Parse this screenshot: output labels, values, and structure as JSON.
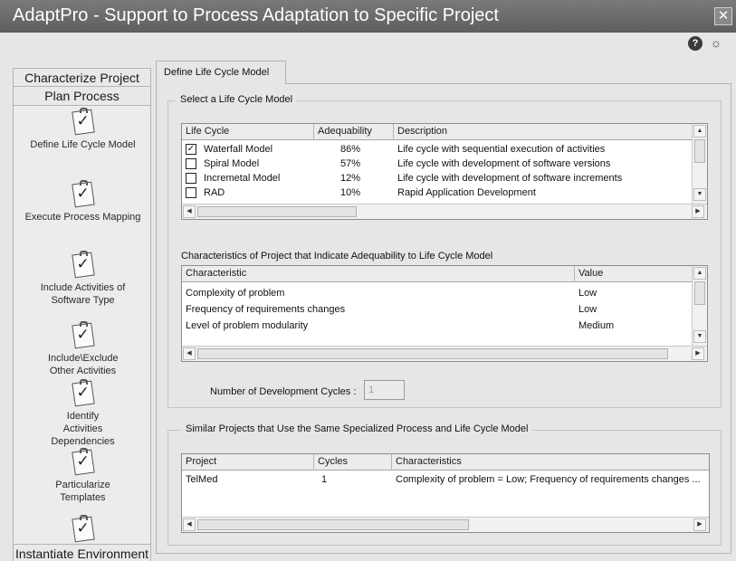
{
  "window": {
    "title": "AdaptPro - Support to Process Adaptation to Specific Project",
    "close_glyph": "✕",
    "help_glyph": "?",
    "bulb_glyph": "☼"
  },
  "sidebar": {
    "characterize_label": "Characterize Project",
    "plan_label": "Plan Process",
    "instantiate_label": "Instantiate Environment",
    "items": [
      {
        "label": "Define Life Cycle Model"
      },
      {
        "label": "Execute Process Mapping"
      },
      {
        "label": "Include Activities of Software Type"
      },
      {
        "label": "Include\\Exclude Other Activities"
      },
      {
        "label": "Identify Activities Dependencies"
      },
      {
        "label": "Particularize Templates"
      }
    ]
  },
  "tabs": [
    {
      "label": "Define Life Cycle Model"
    }
  ],
  "lifecycle_group": {
    "title": "Select a Life Cycle Model",
    "columns": [
      "Life Cycle",
      "Adequability",
      "Description"
    ],
    "rows": [
      {
        "checked": true,
        "name": "Waterfall Model",
        "adequability": "86%",
        "description": "Life cycle with sequential execution of activities"
      },
      {
        "checked": false,
        "name": "Spiral Model",
        "adequability": "57%",
        "description": "Life cycle with development of software versions"
      },
      {
        "checked": false,
        "name": "Incremetal Model",
        "adequability": "12%",
        "description": "Life cycle with development of software increments"
      },
      {
        "checked": false,
        "name": "RAD",
        "adequability": "10%",
        "description": "Rapid Application Development"
      }
    ]
  },
  "characteristics": {
    "caption": "Characteristics of Project that Indicate Adequability to Life Cycle Model",
    "columns": [
      "Characteristic",
      "Value"
    ],
    "rows": [
      {
        "characteristic": "Complexity of problem",
        "value": "Low"
      },
      {
        "characteristic": "Frequency of requirements changes",
        "value": "Low"
      },
      {
        "characteristic": "Level of problem modularity",
        "value": "Medium"
      }
    ]
  },
  "dev_cycles": {
    "label": "Number of Development Cycles :",
    "value": "1"
  },
  "similar_group": {
    "title": "Similar Projects that Use the Same Specialized Process and Life Cycle Model",
    "columns": [
      "Project",
      "Cycles",
      "Characteristics"
    ],
    "rows": [
      {
        "project": "TelMed",
        "cycles": "1",
        "characteristics": "Complexity of problem = Low; Frequency of requirements changes ..."
      }
    ]
  },
  "scroll_glyphs": {
    "up": "▲",
    "down": "▼",
    "left": "◀",
    "right": "▶"
  }
}
